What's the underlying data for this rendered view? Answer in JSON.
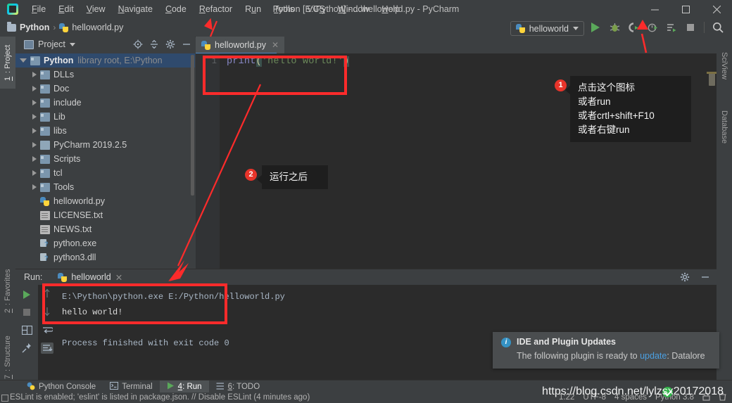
{
  "window": {
    "title": "Python [E:\\Python] - ...\\helloworld.py - PyCharm",
    "minimize": "—",
    "maximize": "▢",
    "close": "✕",
    "logo_name": "pycharm-logo"
  },
  "menubar": {
    "items": [
      {
        "label": "File",
        "mnemonic": "F"
      },
      {
        "label": "Edit",
        "mnemonic": "E"
      },
      {
        "label": "View",
        "mnemonic": "V"
      },
      {
        "label": "Navigate",
        "mnemonic": "N"
      },
      {
        "label": "Code",
        "mnemonic": "C"
      },
      {
        "label": "Refactor",
        "mnemonic": "R"
      },
      {
        "label": "Run",
        "mnemonic": "u"
      },
      {
        "label": "Tools",
        "mnemonic": "T"
      },
      {
        "label": "VCS",
        "mnemonic": "S"
      },
      {
        "label": "Window",
        "mnemonic": "W"
      },
      {
        "label": "Help",
        "mnemonic": "H"
      }
    ]
  },
  "navbar": {
    "breadcrumbs": [
      "Python",
      "helloworld.py"
    ],
    "separator": "›",
    "run_config": "helloworld",
    "toolbar_icons": [
      "run-icon",
      "debug-icon",
      "run-with-coverage-icon",
      "profile-icon",
      "run-dashboard-icon",
      "stop-icon",
      "search-everywhere-icon"
    ]
  },
  "left_strip": {
    "tabs": [
      {
        "label": "1: Project",
        "mnemonic": "1",
        "selected": true
      },
      {
        "label": "2: Favorites",
        "mnemonic": "2",
        "selected": false
      },
      {
        "label": "7: Structure",
        "mnemonic": "7",
        "selected": false
      }
    ]
  },
  "right_strip": {
    "tabs": [
      {
        "label": "SciView"
      },
      {
        "label": "Database"
      }
    ]
  },
  "project_panel": {
    "title": "Project",
    "header_icons": [
      "locate-icon",
      "collapse-all-icon",
      "gear-icon",
      "hide-icon"
    ],
    "tree": [
      {
        "label": "Python",
        "sub": "library root,  E:\\Python",
        "icon": "folder-root-icon",
        "expander": "open",
        "depth": 0,
        "selected": true
      },
      {
        "label": "DLLs",
        "sub": "",
        "icon": "folder-icon",
        "expander": "closed",
        "depth": 1,
        "selected": false
      },
      {
        "label": "Doc",
        "sub": "",
        "icon": "folder-icon",
        "expander": "closed",
        "depth": 1,
        "selected": false
      },
      {
        "label": "include",
        "sub": "",
        "icon": "folder-icon",
        "expander": "closed",
        "depth": 1,
        "selected": false
      },
      {
        "label": "Lib",
        "sub": "",
        "icon": "folder-icon",
        "expander": "closed",
        "depth": 1,
        "selected": false
      },
      {
        "label": "libs",
        "sub": "",
        "icon": "folder-icon",
        "expander": "closed",
        "depth": 1,
        "selected": false
      },
      {
        "label": "PyCharm 2019.2.5",
        "sub": "",
        "icon": "folder-plain-icon",
        "expander": "closed",
        "depth": 1,
        "selected": false
      },
      {
        "label": "Scripts",
        "sub": "",
        "icon": "folder-icon",
        "expander": "closed",
        "depth": 1,
        "selected": false
      },
      {
        "label": "tcl",
        "sub": "",
        "icon": "folder-icon",
        "expander": "closed",
        "depth": 1,
        "selected": false
      },
      {
        "label": "Tools",
        "sub": "",
        "icon": "folder-icon",
        "expander": "closed",
        "depth": 1,
        "selected": false
      },
      {
        "label": "helloworld.py",
        "sub": "",
        "icon": "python-file-icon",
        "expander": "none",
        "depth": 1,
        "selected": false
      },
      {
        "label": "LICENSE.txt",
        "sub": "",
        "icon": "text-file-icon",
        "expander": "none",
        "depth": 1,
        "selected": false
      },
      {
        "label": "NEWS.txt",
        "sub": "",
        "icon": "text-file-icon",
        "expander": "none",
        "depth": 1,
        "selected": false
      },
      {
        "label": "python.exe",
        "sub": "",
        "icon": "unknown-file-icon",
        "expander": "none",
        "depth": 1,
        "selected": false
      },
      {
        "label": "python3.dll",
        "sub": "",
        "icon": "unknown-file-icon",
        "expander": "none",
        "depth": 1,
        "selected": false
      }
    ]
  },
  "editor": {
    "tab_label": "helloworld.py",
    "tab_close": "✕",
    "line_number": "1",
    "code": {
      "func": "print",
      "open_paren": "(",
      "string": "'hello world!'",
      "close_paren": ")"
    }
  },
  "run_panel": {
    "label": "Run:",
    "tab_label": "helloworld",
    "tab_close": "✕",
    "side_icons": [
      "rerun-icon",
      "stop-icon",
      "layout-icon",
      "pin-icon"
    ],
    "side_icons2": [
      "scroll-up-icon",
      "scroll-down-icon",
      "soft-wrap-icon",
      "scroll-to-end-icon"
    ],
    "header_icons": [
      "settings-icon",
      "hide-icon"
    ],
    "console": [
      {
        "text": "E:\\Python\\python.exe E:/Python/helloworld.py",
        "kind": "cmd"
      },
      {
        "text": "hello world!",
        "kind": "out"
      },
      {
        "text": "",
        "kind": "out"
      },
      {
        "text": "Process finished with exit code 0",
        "kind": "fin"
      }
    ]
  },
  "notification": {
    "icon": "info-icon",
    "icon_glyph": "i",
    "title": "IDE and Plugin Updates",
    "body_before": "The following plugin is ready to ",
    "link": "update",
    "body_after": ": Datalore"
  },
  "toolwindow_bar": {
    "items": [
      {
        "label": "Python Console",
        "mnemonic": "",
        "icon": "python-console-icon",
        "selected": false
      },
      {
        "label": "Terminal",
        "mnemonic": "",
        "icon": "terminal-icon",
        "selected": false
      },
      {
        "label": "4: Run",
        "mnemonic": "4",
        "icon": "run-icon",
        "selected": true
      },
      {
        "label": "6: TODO",
        "mnemonic": "6",
        "icon": "todo-icon",
        "selected": false
      }
    ]
  },
  "status_bar": {
    "message": "ESLint is enabled; 'eslint' is listed in package.json. // Disable ESLint (4 minutes ago)",
    "caret": "1:22",
    "encoding": "UTF-8",
    "indent": "4 spaces",
    "interpreter": "Python 3.8",
    "icons": [
      "lock-icon",
      "trash-icon"
    ]
  },
  "annotations": [
    {
      "badge": "1",
      "lines": [
        "点击这个图标",
        "或者run",
        "或者crtl+shift+F10",
        "或者右键run"
      ]
    },
    {
      "badge": "2",
      "lines": [
        "运行之后"
      ]
    }
  ],
  "watermark": {
    "text": "https://blog.csdn.net/lylzsx20172018"
  },
  "colors": {
    "accent_red": "#fd2b2b",
    "run_green": "#5aa85a",
    "link_blue": "#4b9fe0",
    "selection_blue": "#2f4a6d",
    "editor_bg": "#2b2b2b",
    "panel_bg": "#3c3f41"
  }
}
